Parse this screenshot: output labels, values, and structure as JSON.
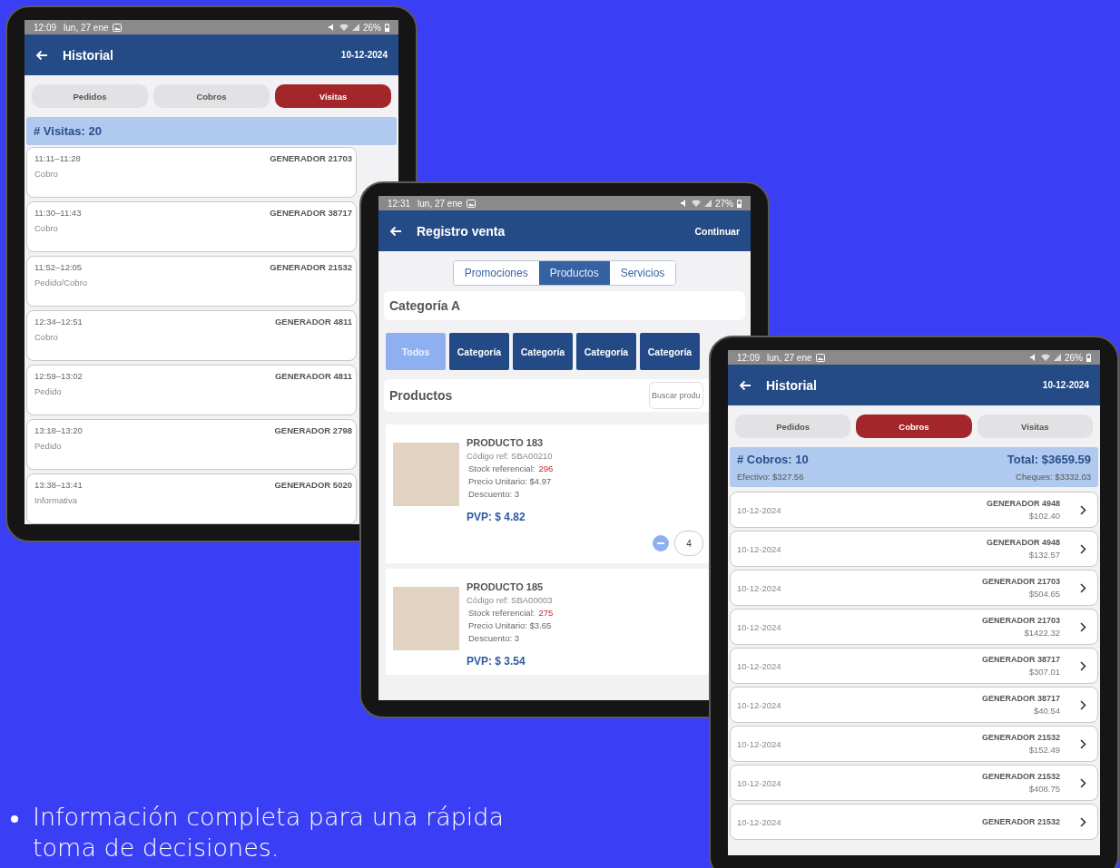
{
  "history_visits": {
    "status_bar": {
      "time": "12:09",
      "date": "lun, 27 ene",
      "battery": "26%"
    },
    "title": "Historial",
    "date": "10-12-2024",
    "tabs": [
      {
        "label": "Pedidos",
        "selected": false
      },
      {
        "label": "Cobros",
        "selected": false
      },
      {
        "label": "Visitas",
        "selected": true
      }
    ],
    "summary": "# Visitas: 20",
    "visits": [
      {
        "time": "11:11–11:28",
        "client": "GENERADOR 21703",
        "type": "Cobro"
      },
      {
        "time": "11:30–11:43",
        "client": "GENERADOR 38717",
        "type": "Cobro"
      },
      {
        "time": "11:52–12:05",
        "client": "GENERADOR 21532",
        "type": "Pedido/Cobro"
      },
      {
        "time": "12:34–12:51",
        "client": "GENERADOR 4811",
        "type": "Cobro"
      },
      {
        "time": "12:59–13:02",
        "client": "GENERADOR 4811",
        "type": "Pedido"
      },
      {
        "time": "13:18–13:20",
        "client": "GENERADOR 2798",
        "type": "Pedido"
      },
      {
        "time": "13:38–13:41",
        "client": "GENERADOR 5020",
        "type": "Informativa"
      }
    ]
  },
  "sale_register": {
    "status_bar": {
      "time": "12:31",
      "date": "lun, 27 ene",
      "battery": "27%"
    },
    "title": "Registro venta",
    "action": "Continuar",
    "segments": [
      {
        "label": "Promociones",
        "selected": false
      },
      {
        "label": "Productos",
        "selected": true
      },
      {
        "label": "Servicios",
        "selected": false
      }
    ],
    "category_title": "Categoría A",
    "categories": [
      {
        "label": "Todos",
        "selected": true
      },
      {
        "label": "Categoría",
        "selected": false
      },
      {
        "label": "Categoría",
        "selected": false
      },
      {
        "label": "Categoría",
        "selected": false
      },
      {
        "label": "Categoría",
        "selected": false
      }
    ],
    "products_title": "Productos",
    "search": {
      "placeholder": "Buscar produ"
    },
    "products": [
      {
        "name": "PRODUCTO 183",
        "code": "Código ref: SBA00210",
        "stock_label": "Stock referencial:",
        "stock": "296",
        "unit_price": "Precio Unitario: $4.97",
        "discount": "Descuento: 3",
        "pvp": "PVP: $ 4.82",
        "quantity": "4"
      },
      {
        "name": "PRODUCTO 185",
        "code": "Código ref: SBA00003",
        "stock_label": "Stock referencial:",
        "stock": "275",
        "unit_price": "Precio Unitario: $3.65",
        "discount": "Descuento: 3",
        "pvp": "PVP: $ 3.54"
      }
    ]
  },
  "history_payments": {
    "status_bar": {
      "time": "12:09",
      "date": "lun, 27 ene",
      "battery": "26%"
    },
    "title": "Historial",
    "date": "10-12-2024",
    "tabs": [
      {
        "label": "Pedidos",
        "selected": false
      },
      {
        "label": "Cobros",
        "selected": true
      },
      {
        "label": "Visitas",
        "selected": false
      }
    ],
    "summary": {
      "count": "# Cobros: 10",
      "total": "Total: $3659.59",
      "cash": "Efectivo: $327.56",
      "checks": "Cheques: $3332.03"
    },
    "payments": [
      {
        "date": "10-12-2024",
        "client": "GENERADOR 4948",
        "amount": "$102.40"
      },
      {
        "date": "10-12-2024",
        "client": "GENERADOR 4948",
        "amount": "$132.57"
      },
      {
        "date": "10-12-2024",
        "client": "GENERADOR 21703",
        "amount": "$504.65"
      },
      {
        "date": "10-12-2024",
        "client": "GENERADOR 21703",
        "amount": "$1422.32"
      },
      {
        "date": "10-12-2024",
        "client": "GENERADOR 38717",
        "amount": "$307.01"
      },
      {
        "date": "10-12-2024",
        "client": "GENERADOR 38717",
        "amount": "$40.54"
      },
      {
        "date": "10-12-2024",
        "client": "GENERADOR 21532",
        "amount": "$152.49"
      },
      {
        "date": "10-12-2024",
        "client": "GENERADOR 21532",
        "amount": "$408.75"
      },
      {
        "date": "10-12-2024",
        "client": "GENERADOR 21532"
      }
    ]
  },
  "caption": "Información completa para una rápida toma de decisiones."
}
